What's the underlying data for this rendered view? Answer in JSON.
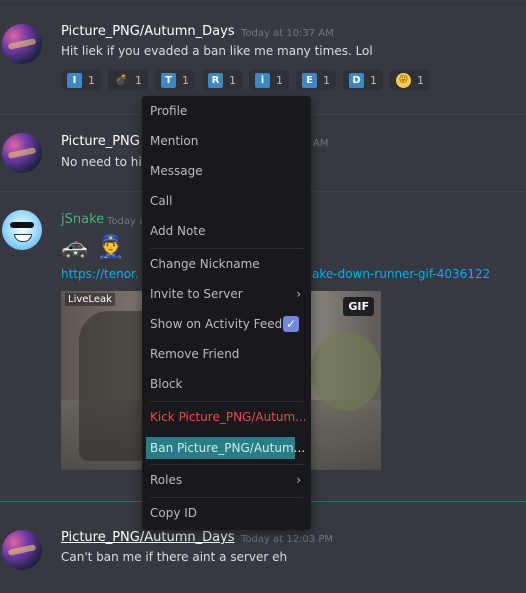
{
  "messages": {
    "m1": {
      "author": "Picture_PNG/Autumn_Days",
      "time": "Today at 10:37 AM",
      "text": "Hit liek if you evaded a ban like me many times. Lol"
    },
    "m2": {
      "author": "Picture_PNG",
      "time": "AM",
      "text": "No need to hic"
    },
    "m3": {
      "author": "jSnake",
      "time": "Today a",
      "link_start": "https://tenor.",
      "link_end": "ake-down-runner-gif-4036122",
      "gif_badge": "GIF",
      "gif_watermark": "LiveLeak"
    },
    "m4": {
      "author": "Picture_PNG/Autumn_Days",
      "time": "Today at 12:03 PM",
      "text": "Can't ban me if there aint a server eh"
    }
  },
  "reactions": [
    {
      "glyph": "I",
      "count": "1",
      "icon": "regional-i-icon"
    },
    {
      "glyph": "💣",
      "count": "1",
      "icon": "bomb-icon"
    },
    {
      "glyph": "T",
      "count": "1",
      "icon": "regional-t-icon"
    },
    {
      "glyph": "R",
      "count": "1",
      "icon": "regional-r-icon"
    },
    {
      "glyph": "i",
      "count": "1",
      "icon": "information-icon"
    },
    {
      "glyph": "E",
      "count": "1",
      "icon": "regional-e-icon"
    },
    {
      "glyph": "D",
      "count": "1",
      "icon": "regional-d-icon"
    },
    {
      "glyph": "😛",
      "count": "1",
      "icon": "tongue-face-icon"
    }
  ],
  "emojis": {
    "police_car": "🚓",
    "police_officer": "👮"
  },
  "menu": {
    "profile": "Profile",
    "mention": "Mention",
    "message": "Message",
    "call": "Call",
    "add_note": "Add Note",
    "change_nickname": "Change Nickname",
    "invite_to_server": "Invite to Server",
    "show_on_activity_feed": "Show on Activity Feed",
    "remove_friend": "Remove Friend",
    "block": "Block",
    "kick": "Kick Picture_PNG/Autum...",
    "ban": "Ban Picture_PNG/Autum...",
    "roles": "Roles",
    "copy_id": "Copy ID",
    "chevron": "›",
    "check": "✓"
  },
  "colors": {
    "accent": "#7289da",
    "danger": "#f04747",
    "highlight": "#297e85",
    "link": "#00b0f4",
    "username_green": "#43b581"
  }
}
